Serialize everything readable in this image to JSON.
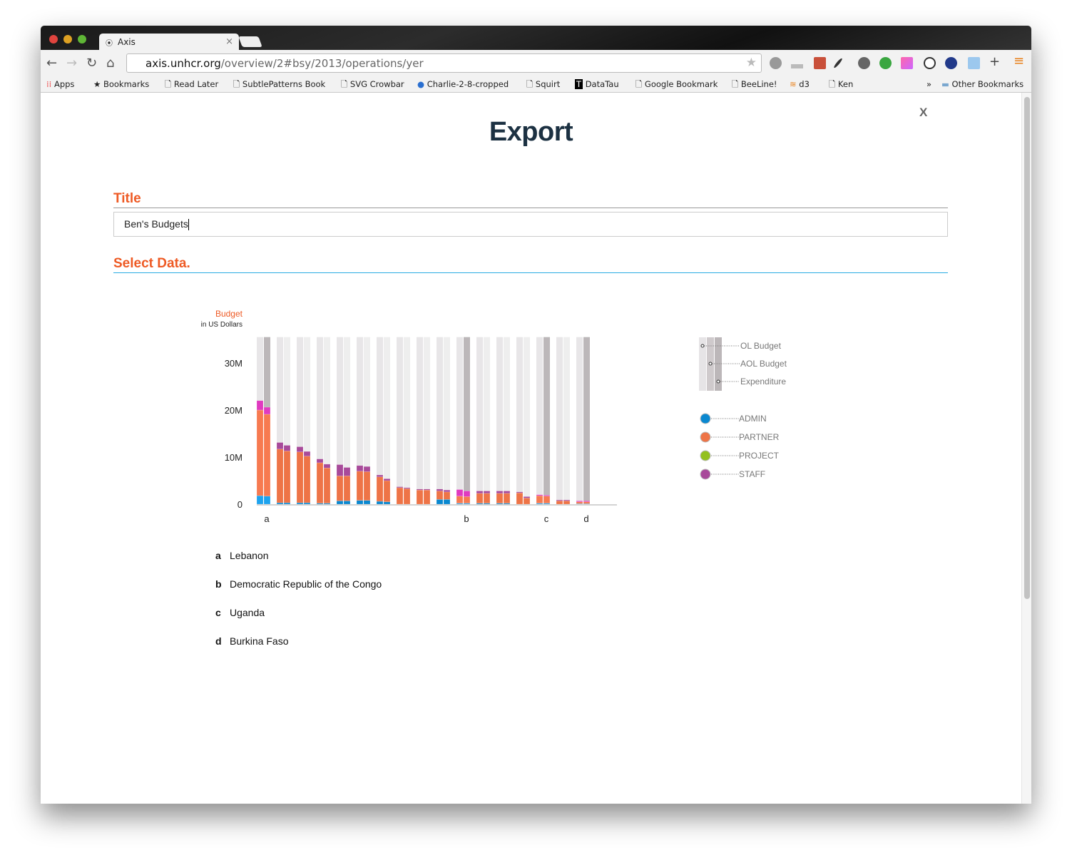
{
  "browser": {
    "tab_title": "Axis",
    "url_host": "axis.unhcr.org",
    "url_path": "/overview/2#bsy/2013/operations/yer",
    "bookmarks": [
      "Apps",
      "Bookmarks",
      "Read Later",
      "SubtlePatterns Book",
      "SVG Crowbar",
      "Charlie-2-8-cropped",
      "Squirt",
      "DataTau",
      "Google Bookmark",
      "BeeLine!",
      "d3",
      "Ken"
    ],
    "overflow": "»",
    "other_bookmarks": "Other Bookmarks"
  },
  "page": {
    "heading": "Export",
    "close_label": "X",
    "title_section": "Title",
    "title_value": "Ben's Budgets",
    "select_section": "Select Data."
  },
  "colors": {
    "accent": "#ee5a24",
    "rule_blue": "#29abe2",
    "admin": "#0a88d0",
    "partner": "#ee7447",
    "project": "#93c01f",
    "staff": "#a84a9a"
  },
  "chart_data": {
    "type": "bar",
    "stacked": true,
    "ylabel": "Budget",
    "ylabel_sub": "in US Dollars",
    "yticks": [
      "0",
      "10M",
      "20M",
      "30M"
    ],
    "ytick_values": [
      0,
      10000000,
      20000000,
      30000000
    ],
    "ylim": [
      0,
      35500000
    ],
    "markers": [
      "a",
      "b",
      "c",
      "d"
    ],
    "marker_groups": [
      0,
      10,
      14,
      16
    ],
    "measure_legend": [
      "OL Budget",
      "AOL Budget",
      "Expenditure"
    ],
    "series_legend": [
      {
        "name": "ADMIN",
        "color": "#0a88d0"
      },
      {
        "name": "PARTNER",
        "color": "#ee7447"
      },
      {
        "name": "PROJECT",
        "color": "#93c01f"
      },
      {
        "name": "STAFF",
        "color": "#a84a9a"
      }
    ],
    "groups_millions": [
      [
        [
          1.8,
          18.2,
          0,
          2.0
        ],
        [
          1.7,
          17.4,
          0,
          1.5
        ]
      ],
      [
        [
          0.3,
          11.4,
          0,
          1.4
        ],
        [
          0.3,
          11.0,
          0,
          1.2
        ]
      ],
      [
        [
          0.3,
          10.8,
          0,
          1.1
        ],
        [
          0.3,
          9.9,
          0,
          1.0
        ]
      ],
      [
        [
          0.2,
          8.6,
          0,
          0.8
        ],
        [
          0.2,
          7.5,
          0,
          0.8
        ]
      ],
      [
        [
          0.7,
          5.3,
          0,
          2.4
        ],
        [
          0.7,
          5.3,
          0,
          1.8
        ]
      ],
      [
        [
          0.8,
          6.2,
          0,
          1.2
        ],
        [
          0.8,
          6.1,
          0,
          1.1
        ]
      ],
      [
        [
          0.6,
          5.2,
          0,
          0.4
        ],
        [
          0.5,
          4.5,
          0,
          0.4
        ]
      ],
      [
        [
          0,
          3.5,
          0,
          0.2
        ],
        [
          0,
          3.3,
          0,
          0.2
        ]
      ],
      [
        [
          0,
          3.0,
          0,
          0.2
        ],
        [
          0,
          3.0,
          0,
          0.2
        ]
      ],
      [
        [
          1.0,
          1.8,
          0,
          0.4
        ],
        [
          1.0,
          1.6,
          0,
          0.4
        ]
      ],
      [
        [
          0.2,
          1.5,
          0,
          1.4
        ],
        [
          0.2,
          1.4,
          0,
          1.2
        ]
      ],
      [
        [
          0.2,
          2.1,
          0,
          0.5
        ],
        [
          0.2,
          2.1,
          0,
          0.5
        ]
      ],
      [
        [
          0.2,
          2.1,
          0,
          0.5
        ],
        [
          0.2,
          2.1,
          0,
          0.5
        ]
      ],
      [
        [
          0,
          2.4,
          0,
          0.2
        ],
        [
          0,
          1.3,
          0,
          0.3
        ]
      ],
      [
        [
          0.2,
          1.6,
          0,
          0.2
        ],
        [
          0.2,
          1.5,
          0,
          0.2
        ]
      ],
      [
        [
          0,
          0.7,
          0,
          0.2
        ],
        [
          0,
          0.7,
          0,
          0.2
        ]
      ],
      [
        [
          0.1,
          0.4,
          0,
          0.2
        ],
        [
          0.1,
          0.4,
          0,
          0.2
        ]
      ]
    ]
  },
  "footnotes": [
    {
      "key": "a",
      "label": "Lebanon"
    },
    {
      "key": "b",
      "label": "Democratic Republic of the Congo"
    },
    {
      "key": "c",
      "label": "Uganda"
    },
    {
      "key": "d",
      "label": "Burkina Faso"
    }
  ]
}
